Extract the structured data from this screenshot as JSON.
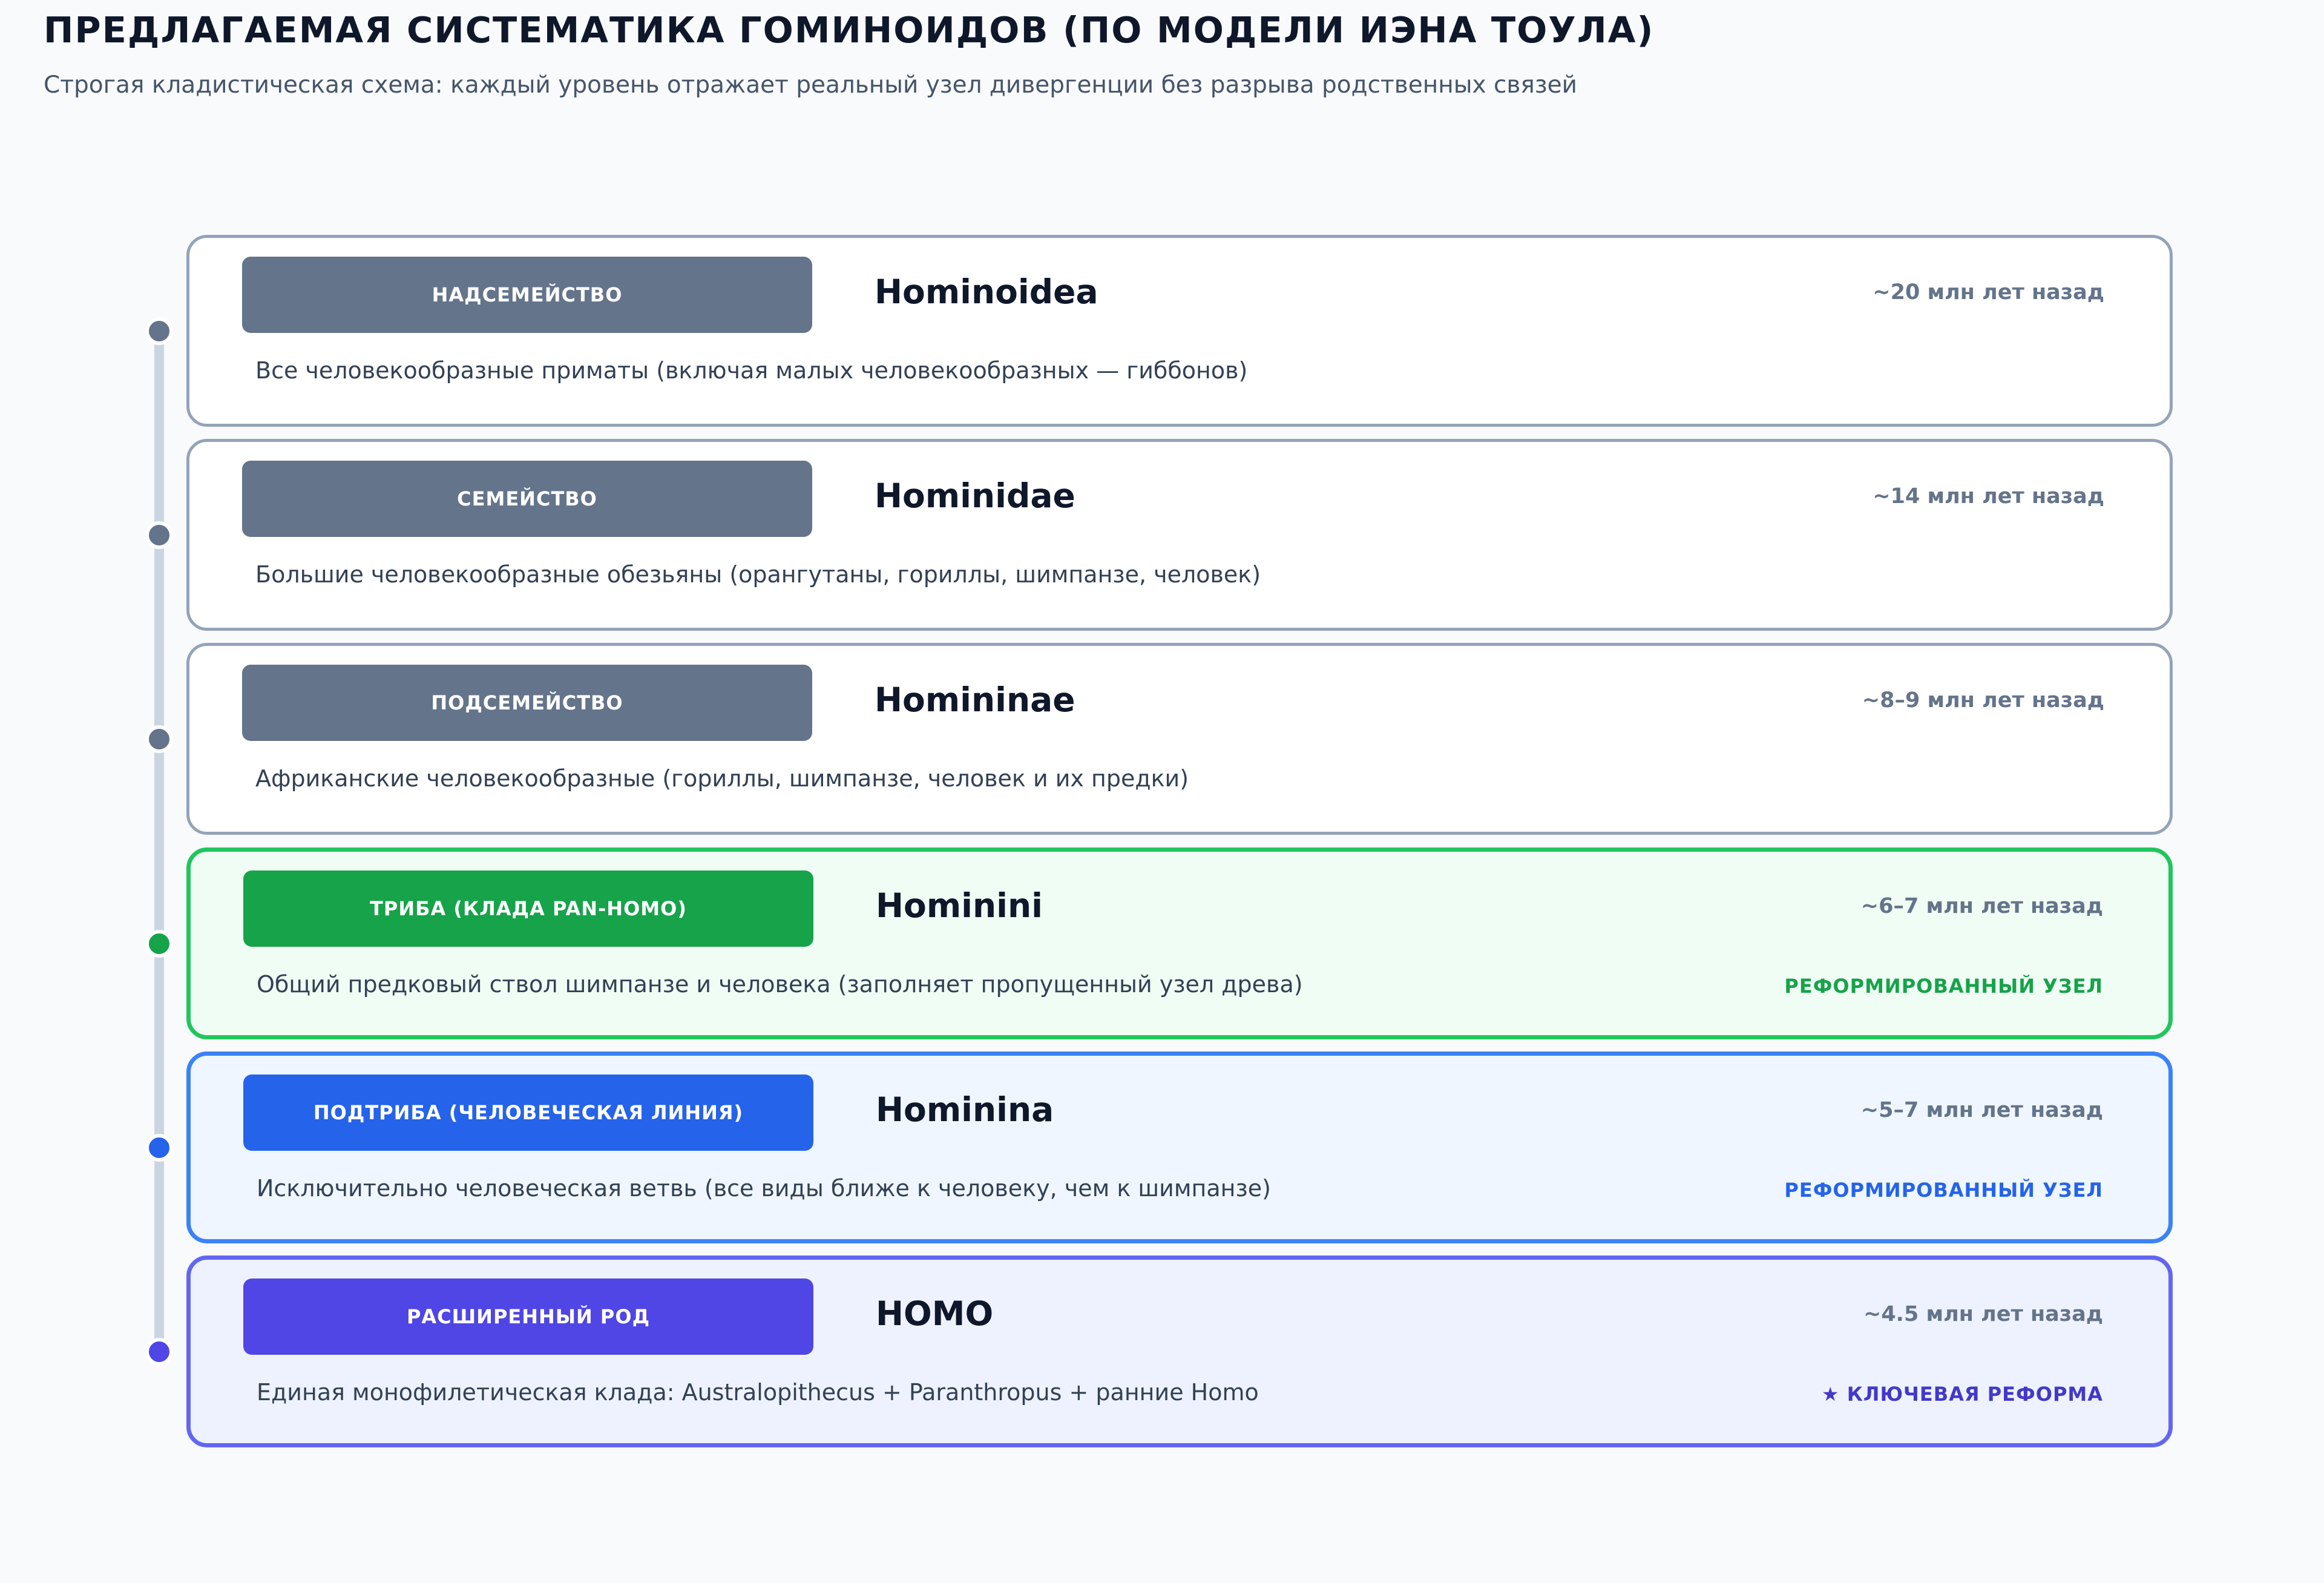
{
  "header": {
    "title": "ПРЕДЛАГАЕМАЯ СИСТЕМАТИКА ГОМИНОИДОВ (ПО МОДЕЛИ ИЭНА ТОУЛА)",
    "subtitle": "Строгая кладистическая схема: каждый уровень отражает реальный узел дивергенции без разрыва родственных связей"
  },
  "colors": {
    "neutral": "#64748b",
    "green": "#16a34a",
    "blue": "#2563eb",
    "indigo": "#4f46e5",
    "timeline": "#cbd5e1"
  },
  "levels": [
    {
      "rank": "НАДСЕМЕЙСТВО",
      "name": "Hominoidea",
      "time": "~20 млн лет назад",
      "description": "Все человекообразные приматы (включая малых человекообразных — гиббонов)",
      "tag": "",
      "accent": "neutral"
    },
    {
      "rank": "СЕМЕЙСТВО",
      "name": "Hominidae",
      "time": "~14 млн лет назад",
      "description": "Большие человекообразные обезьяны (орангутаны, гориллы, шимпанзе, человек)",
      "tag": "",
      "accent": "neutral"
    },
    {
      "rank": "ПОДСЕМЕЙСТВО",
      "name": "Homininae",
      "time": "~8–9 млн лет назад",
      "description": "Африканские человекообразные (гориллы, шимпанзе, человек и их предки)",
      "tag": "",
      "accent": "neutral"
    },
    {
      "rank": "ТРИБА (КЛАДА PAN-HOMO)",
      "name": "Hominini",
      "time": "~6–7 млн лет назад",
      "description": "Общий предковый ствол шимпанзе и человека (заполняет пропущенный узел древа)",
      "tag": "РЕФОРМИРОВАННЫЙ УЗЕЛ",
      "accent": "green"
    },
    {
      "rank": "ПОДТРИБА (ЧЕЛОВЕЧЕСКАЯ ЛИНИЯ)",
      "name": "Hominina",
      "time": "~5–7 млн лет назад",
      "description": "Исключительно человеческая ветвь (все виды ближе к человеку, чем к шимпанзе)",
      "tag": "РЕФОРМИРОВАННЫЙ УЗЕЛ",
      "accent": "blue"
    },
    {
      "rank": "РАСШИРЕННЫЙ РОД",
      "name": "HOMO",
      "time": "~4.5 млн лет назад",
      "description": "Единая монофилетическая клада: Australopithecus + Paranthropus + ранние Homo",
      "tag": "★ КЛЮЧЕВАЯ РЕФОРМА",
      "accent": "indigo"
    }
  ]
}
